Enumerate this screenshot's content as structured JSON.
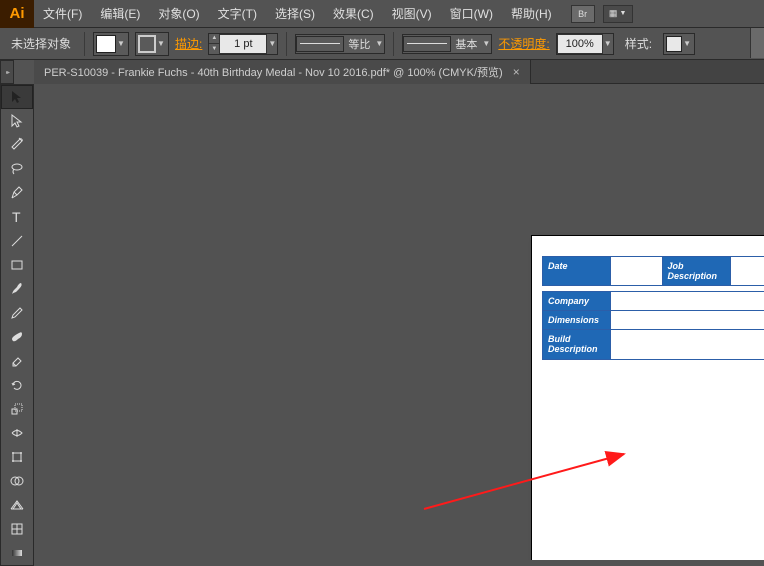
{
  "app": {
    "logo": "Ai"
  },
  "menu": {
    "items": [
      "文件(F)",
      "编辑(E)",
      "对象(O)",
      "文字(T)",
      "选择(S)",
      "效果(C)",
      "视图(V)",
      "窗口(W)",
      "帮助(H)"
    ],
    "right_btn1": "Br",
    "right_btn2": "▦"
  },
  "options": {
    "no_selection": "未选择对象",
    "stroke_label": "描边:",
    "stroke_weight": "1 pt",
    "uniform": "等比",
    "basic": "基本",
    "opacity_label": "不透明度:",
    "opacity_value": "100%",
    "style_label": "样式:"
  },
  "document": {
    "tab_title": "PER-S10039 - Frankie Fuchs - 40th Birthday Medal - Nov 10 2016.pdf* @ 100% (CMYK/预览)"
  },
  "artboard": {
    "labels": {
      "date": "Date",
      "job": "Job Description",
      "company": "Company",
      "dimensions": "Dimensions",
      "build": "Build Description"
    }
  }
}
